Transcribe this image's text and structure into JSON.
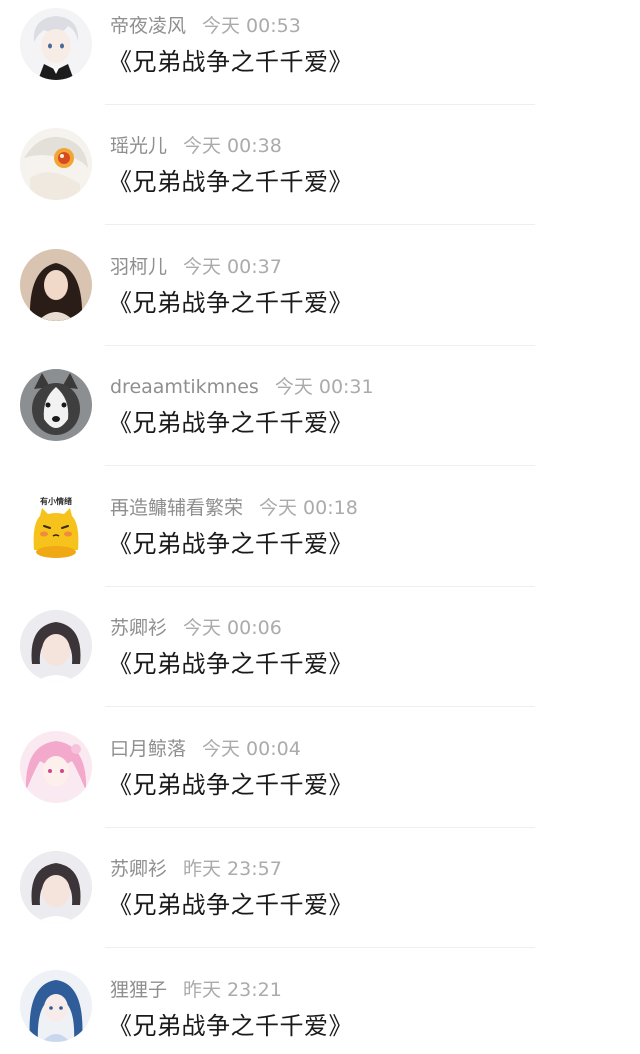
{
  "comments": [
    {
      "username": "帝夜凌风",
      "time": "今天 00:53",
      "message": "《兄弟战争之千千爱》",
      "avatar": "avatar-anime-white-hair-icon"
    },
    {
      "username": "瑶光儿",
      "time": "今天 00:38",
      "message": "《兄弟战争之千千爱》",
      "avatar": "avatar-anime-orange-eye-icon"
    },
    {
      "username": "羽柯儿",
      "time": "今天 00:37",
      "message": "《兄弟战争之千千爱》",
      "avatar": "avatar-girl-photo-icon"
    },
    {
      "username": "dreaamtikmnes",
      "time": "今天 00:31",
      "message": "《兄弟战争之千千爱》",
      "avatar": "avatar-husky-dog-icon"
    },
    {
      "username": "再造鳙辅看繁荣",
      "time": "今天 00:18",
      "message": "《兄弟战争之千千爱》",
      "avatar": "avatar-yellow-cat-icon",
      "avatar_caption": "有小情绪"
    },
    {
      "username": "苏卿衫",
      "time": "今天 00:06",
      "message": "《兄弟战争之千千爱》",
      "avatar": "avatar-girl-short-hair-icon"
    },
    {
      "username": "曰月鲸落",
      "time": "今天 00:04",
      "message": "《兄弟战争之千千爱》",
      "avatar": "avatar-anime-pink-hair-icon"
    },
    {
      "username": "苏卿衫",
      "time": "昨天 23:57",
      "message": "《兄弟战争之千千爱》",
      "avatar": "avatar-girl-short-hair-icon"
    },
    {
      "username": "狸狸子",
      "time": "昨天 23:21",
      "message": "《兄弟战争之千千爱》",
      "avatar": "avatar-anime-blue-hair-icon"
    }
  ]
}
